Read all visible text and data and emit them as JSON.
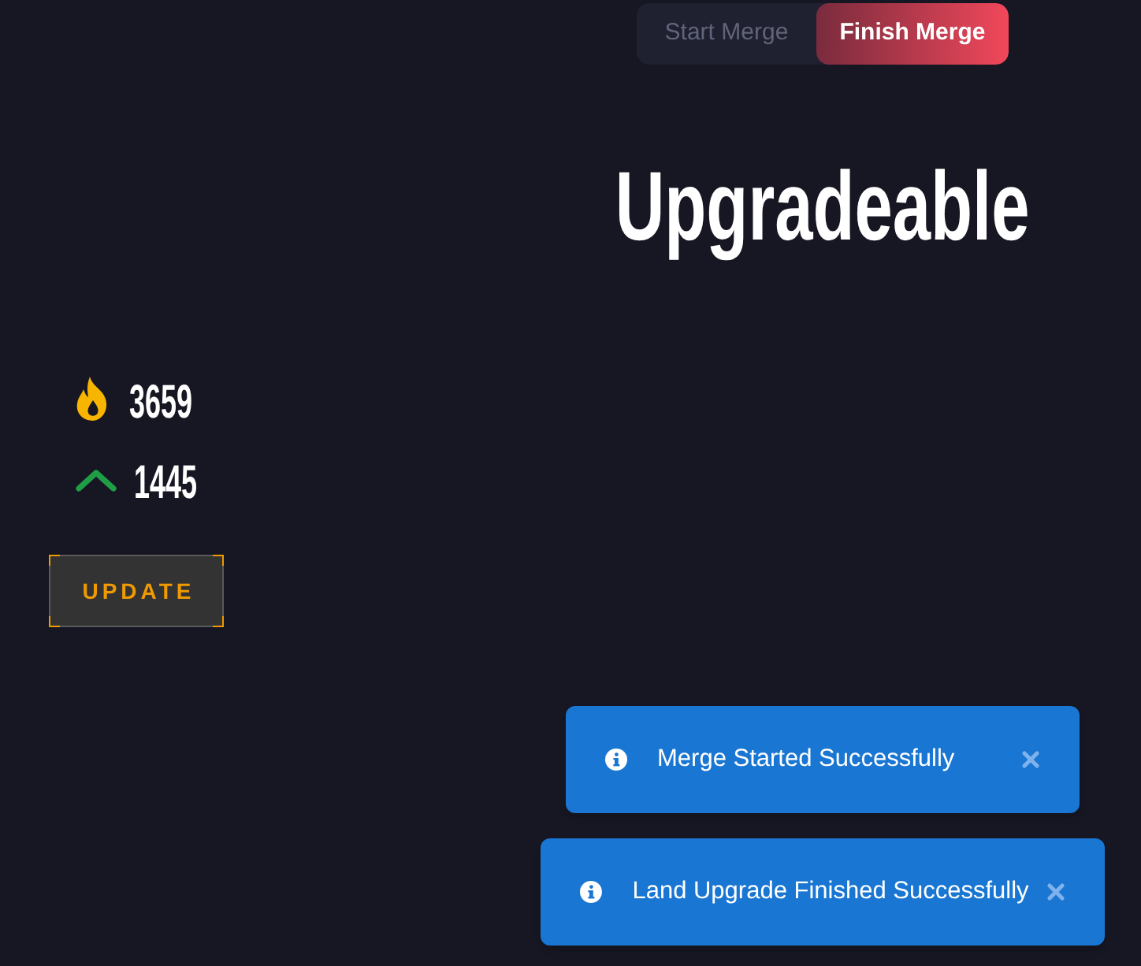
{
  "merge_toggle": [
    {
      "label": "Start Merge",
      "selected": false
    },
    {
      "label": "Finish Merge",
      "selected": true
    }
  ],
  "stats": [
    {
      "kind": "fire",
      "value": "3659"
    },
    {
      "kind": "upgrade",
      "value": "1445"
    }
  ],
  "update_button": {
    "label": "UPDATE"
  },
  "sections": [
    {
      "title": "Upgradeable"
    }
  ],
  "toasts": [
    {
      "message": "Merge Started Successfully"
    },
    {
      "message": "Land Upgrade Finished Successfully"
    }
  ]
}
